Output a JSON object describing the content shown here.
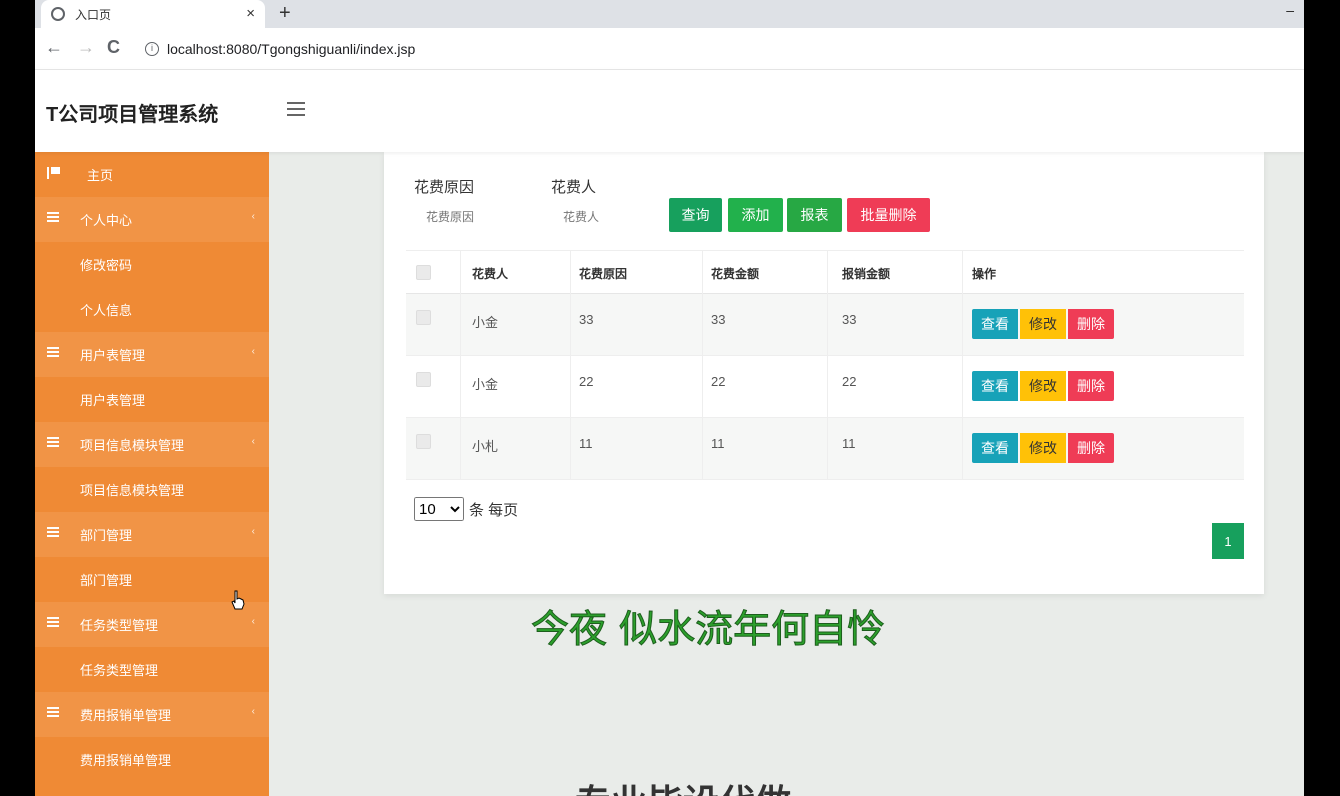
{
  "browser": {
    "tab_title": "入口页",
    "tab_close": "×",
    "new_tab": "+",
    "win_min": "–",
    "back": "←",
    "forward": "→",
    "reload": "C",
    "url": "localhost:8080/Tgongshiguanli/index.jsp"
  },
  "header": {
    "title": "T公司项目管理系统"
  },
  "sidebar": {
    "items": [
      {
        "label": "主页",
        "type": "home"
      },
      {
        "label": "个人中心",
        "type": "parent"
      },
      {
        "label": "修改密码",
        "type": "sub"
      },
      {
        "label": "个人信息",
        "type": "sub"
      },
      {
        "label": "用户表管理",
        "type": "parent"
      },
      {
        "label": "用户表管理",
        "type": "sub"
      },
      {
        "label": "项目信息模块管理",
        "type": "parent"
      },
      {
        "label": "项目信息模块管理",
        "type": "sub"
      },
      {
        "label": "部门管理",
        "type": "parent"
      },
      {
        "label": "部门管理",
        "type": "sub"
      },
      {
        "label": "任务类型管理",
        "type": "parent"
      },
      {
        "label": "任务类型管理",
        "type": "sub"
      },
      {
        "label": "费用报销单管理",
        "type": "parent"
      },
      {
        "label": "费用报销单管理",
        "type": "sub"
      }
    ]
  },
  "filters": {
    "reason_label": "花费原因",
    "reason_placeholder": "花费原因",
    "person_label": "花费人",
    "person_placeholder": "花费人"
  },
  "buttons": {
    "query": "查询",
    "add": "添加",
    "report": "报表",
    "batch_delete": "批量删除"
  },
  "table": {
    "headers": [
      "花费人",
      "花费原因",
      "花费金额",
      "报销金额",
      "操作"
    ],
    "rows": [
      {
        "person": "小金",
        "reason": "33",
        "amount": "33",
        "reimburse": "33"
      },
      {
        "person": "小金",
        "reason": "22",
        "amount": "22",
        "reimburse": "22"
      },
      {
        "person": "小札",
        "reason": "11",
        "amount": "11",
        "reimburse": "11"
      }
    ],
    "actions": {
      "view": "查看",
      "edit": "修改",
      "delete": "删除"
    }
  },
  "pagination": {
    "page_size": "10",
    "per_page_label": "条 每页",
    "current_page": "1"
  },
  "overlay": {
    "background_text": "专业毕设代做",
    "subtitle": "今夜 似水流年何自怜"
  },
  "colors": {
    "sidebar": "#ef8a35",
    "primary_green": "#17a05d",
    "danger": "#ef3c56",
    "info": "#17a2b8",
    "warning": "#ffc107"
  }
}
